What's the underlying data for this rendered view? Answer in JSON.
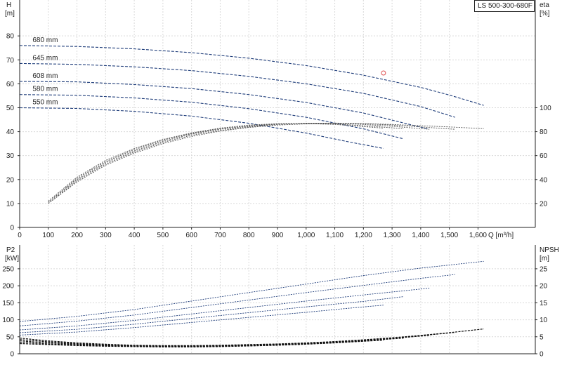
{
  "colors": {
    "curve": "#1f3d7a",
    "eta": "#555555",
    "npsh": "#111111",
    "point": "#e05050",
    "grid": "#d9d9d9"
  },
  "title": "LS 500-300-680F",
  "chart_data": [
    {
      "type": "line",
      "title": "LS 500-300-680F",
      "xlabel": "Q [m³/h]",
      "xlim": [
        0,
        1800
      ],
      "x_ticks": [
        0,
        100,
        200,
        300,
        400,
        500,
        600,
        700,
        800,
        900,
        1000,
        1100,
        1200,
        1300,
        1400,
        1500,
        1600
      ],
      "x_tick_labels": [
        "0",
        "100",
        "200",
        "300",
        "400",
        "500",
        "600",
        "700",
        "800",
        "900",
        "1,000",
        "1,100",
        "1,200",
        "1,300",
        "1,400",
        "1,500",
        "1,600"
      ],
      "ylabel_left": [
        "H",
        "[m]"
      ],
      "ylim_left": [
        0,
        95
      ],
      "y_ticks_left": [
        0,
        10,
        20,
        30,
        40,
        50,
        60,
        70,
        80
      ],
      "ylabel_right": [
        "eta",
        "[%]"
      ],
      "ylim_right": [
        0,
        190
      ],
      "y_ticks_right": [
        20,
        40,
        60,
        80,
        100
      ],
      "grid": true,
      "head_series": [
        {
          "name": "680 mm",
          "x": [
            0,
            200,
            400,
            600,
            800,
            1000,
            1200,
            1400,
            1500,
            1620
          ],
          "y": [
            76,
            75.6,
            74.6,
            73,
            70.7,
            67.6,
            63.6,
            58.5,
            55.3,
            51
          ]
        },
        {
          "name": "645 mm",
          "x": [
            0,
            200,
            400,
            600,
            800,
            1000,
            1200,
            1400,
            1520
          ],
          "y": [
            68.5,
            68.1,
            67.1,
            65.5,
            63.1,
            60,
            56,
            50.5,
            46
          ]
        },
        {
          "name": "608 mm",
          "x": [
            0,
            200,
            400,
            600,
            800,
            1000,
            1200,
            1430
          ],
          "y": [
            61,
            60.8,
            59.7,
            58,
            55.5,
            52.2,
            47.8,
            41
          ]
        },
        {
          "name": "580 mm",
          "x": [
            0,
            200,
            400,
            600,
            800,
            1000,
            1200,
            1340
          ],
          "y": [
            55.5,
            55.2,
            54.1,
            52.3,
            49.6,
            46,
            41.2,
            37
          ]
        },
        {
          "name": "550 mm",
          "x": [
            0,
            200,
            400,
            600,
            800,
            1000,
            1150,
            1270
          ],
          "y": [
            50,
            49.7,
            48.5,
            46.5,
            43.5,
            39.4,
            35.7,
            33
          ]
        }
      ],
      "eta_series": [
        {
          "name": "680 mm",
          "x": [
            100,
            200,
            300,
            400,
            500,
            600,
            700,
            800,
            900,
            1000,
            1100,
            1200,
            1300,
            1400,
            1500,
            1620
          ],
          "y": [
            20,
            38,
            52,
            62,
            70,
            76,
            80.5,
            83.5,
            85.5,
            86.5,
            87,
            86.8,
            86,
            85,
            84,
            82.5
          ]
        },
        {
          "name": "645 mm",
          "x": [
            100,
            200,
            300,
            400,
            500,
            600,
            700,
            800,
            900,
            1000,
            1100,
            1200,
            1300,
            1400,
            1520
          ],
          "y": [
            20,
            39,
            53,
            63,
            71,
            77,
            81,
            84,
            86,
            87,
            87.2,
            86.7,
            85.5,
            84,
            82
          ]
        },
        {
          "name": "608 mm",
          "x": [
            100,
            200,
            300,
            400,
            500,
            600,
            700,
            800,
            900,
            1000,
            1100,
            1200,
            1300,
            1430
          ],
          "y": [
            21,
            40,
            54,
            64,
            72,
            78,
            82,
            84.5,
            86.3,
            87.1,
            87,
            86,
            84.5,
            82
          ]
        },
        {
          "name": "580 mm",
          "x": [
            100,
            200,
            300,
            400,
            500,
            600,
            700,
            800,
            900,
            1000,
            1100,
            1200,
            1340
          ],
          "y": [
            21,
            41,
            55,
            65,
            73,
            78.5,
            82.5,
            85,
            86.5,
            87,
            86.5,
            85,
            82.5
          ]
        },
        {
          "name": "550 mm",
          "x": [
            100,
            200,
            300,
            400,
            500,
            600,
            700,
            800,
            900,
            1000,
            1100,
            1270
          ],
          "y": [
            22,
            42,
            56,
            66,
            73.5,
            79,
            83,
            85.5,
            86.7,
            86.8,
            86,
            83
          ]
        }
      ],
      "marker": {
        "x": 1270,
        "y": 64.5
      },
      "curve_labels": [
        "680 mm",
        "645 mm",
        "608 mm",
        "580 mm",
        "550 mm"
      ]
    },
    {
      "type": "line",
      "xlim": [
        0,
        1800
      ],
      "ylabel_left": [
        "P2",
        "[kW]"
      ],
      "ylim_left": [
        0,
        320
      ],
      "y_ticks_left": [
        0,
        50,
        100,
        150,
        200,
        250
      ],
      "ylabel_right": [
        "NPSH",
        "[m]"
      ],
      "ylim_right": [
        0,
        32
      ],
      "y_ticks_right": [
        0,
        5,
        10,
        15,
        20,
        25
      ],
      "grid": true,
      "power_series": [
        {
          "name": "680 mm",
          "x": [
            0,
            200,
            400,
            600,
            800,
            1000,
            1200,
            1400,
            1620
          ],
          "y": [
            95,
            110,
            130,
            155,
            180,
            205,
            230,
            252,
            272
          ]
        },
        {
          "name": "645 mm",
          "x": [
            0,
            200,
            400,
            600,
            800,
            1000,
            1200,
            1400,
            1520
          ],
          "y": [
            82,
            96,
            114,
            136,
            158,
            180,
            201,
            222,
            233
          ]
        },
        {
          "name": "608 mm",
          "x": [
            0,
            200,
            400,
            600,
            800,
            1000,
            1200,
            1430
          ],
          "y": [
            70,
            82,
            98,
            117,
            136,
            155,
            173,
            193
          ]
        },
        {
          "name": "580 mm",
          "x": [
            0,
            200,
            400,
            600,
            800,
            1000,
            1200,
            1340
          ],
          "y": [
            62,
            72,
            87,
            104,
            121,
            138,
            154,
            168
          ]
        },
        {
          "name": "550 mm",
          "x": [
            0,
            200,
            400,
            600,
            800,
            1000,
            1150,
            1270
          ],
          "y": [
            55,
            64,
            77,
            92,
            107,
            122,
            134,
            143
          ]
        }
      ],
      "npsh_series": [
        {
          "name": "680 mm",
          "x": [
            0,
            100,
            200,
            300,
            400,
            500,
            600,
            700,
            800,
            900,
            1000,
            1100,
            1200,
            1300,
            1400,
            1500,
            1620
          ],
          "y": [
            4.6,
            3.8,
            3.2,
            2.8,
            2.5,
            2.4,
            2.4,
            2.5,
            2.7,
            2.9,
            3.2,
            3.6,
            4.1,
            4.7,
            5.4,
            6.2,
            7.3
          ]
        },
        {
          "name": "645 mm",
          "x": [
            0,
            100,
            200,
            300,
            400,
            500,
            600,
            700,
            800,
            900,
            1000,
            1100,
            1200,
            1300,
            1400,
            1520
          ],
          "y": [
            4.2,
            3.5,
            3.0,
            2.6,
            2.4,
            2.3,
            2.3,
            2.4,
            2.6,
            2.8,
            3.1,
            3.5,
            4.0,
            4.6,
            5.3,
            6.3
          ]
        },
        {
          "name": "608 mm",
          "x": [
            0,
            100,
            200,
            300,
            400,
            500,
            600,
            700,
            800,
            900,
            1000,
            1100,
            1200,
            1300,
            1430
          ],
          "y": [
            3.8,
            3.2,
            2.8,
            2.5,
            2.3,
            2.2,
            2.2,
            2.3,
            2.5,
            2.7,
            3.0,
            3.4,
            3.9,
            4.5,
            5.4
          ]
        },
        {
          "name": "580 mm",
          "x": [
            0,
            100,
            200,
            300,
            400,
            500,
            600,
            700,
            800,
            900,
            1000,
            1100,
            1200,
            1340
          ],
          "y": [
            3.4,
            2.9,
            2.6,
            2.4,
            2.2,
            2.1,
            2.1,
            2.2,
            2.4,
            2.6,
            2.9,
            3.3,
            3.8,
            4.6
          ]
        },
        {
          "name": "550 mm",
          "x": [
            0,
            100,
            200,
            300,
            400,
            500,
            600,
            700,
            800,
            900,
            1000,
            1100,
            1270
          ],
          "y": [
            3.0,
            2.7,
            2.4,
            2.2,
            2.1,
            2.0,
            2.0,
            2.1,
            2.3,
            2.5,
            2.8,
            3.2,
            4.0
          ]
        }
      ]
    }
  ]
}
